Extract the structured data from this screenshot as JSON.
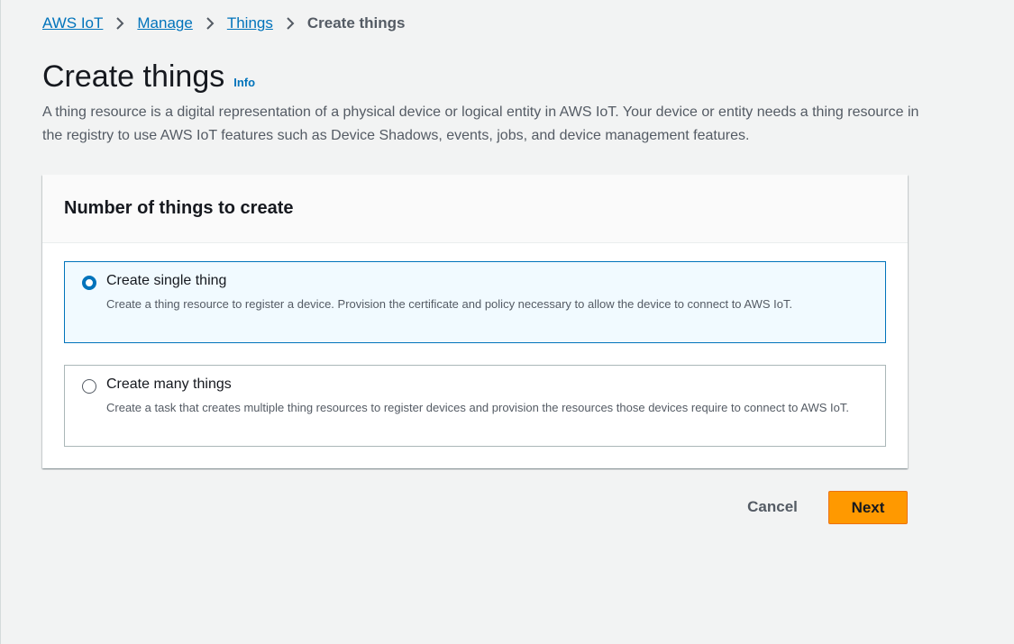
{
  "breadcrumb": {
    "items": [
      {
        "label": "AWS IoT"
      },
      {
        "label": "Manage"
      },
      {
        "label": "Things"
      }
    ],
    "current": "Create things"
  },
  "header": {
    "title": "Create things",
    "info_label": "Info",
    "description": "A thing resource is a digital representation of a physical device or logical entity in AWS IoT. Your device or entity needs a thing resource in the registry to use AWS IoT features such as Device Shadows, events, jobs, and device management features."
  },
  "panel": {
    "title": "Number of things to create",
    "options": [
      {
        "label": "Create single thing",
        "description": "Create a thing resource to register a device. Provision the certificate and policy necessary to allow the device to connect to AWS IoT.",
        "selected": true
      },
      {
        "label": "Create many things",
        "description": "Create a task that creates multiple thing resources to register devices and provision the resources those devices require to connect to AWS IoT.",
        "selected": false
      }
    ]
  },
  "actions": {
    "cancel_label": "Cancel",
    "next_label": "Next"
  },
  "colors": {
    "link": "#0073bb",
    "primary_button": "#ff9900",
    "selected_bg": "#f1faff",
    "page_bg": "#f2f3f3"
  }
}
